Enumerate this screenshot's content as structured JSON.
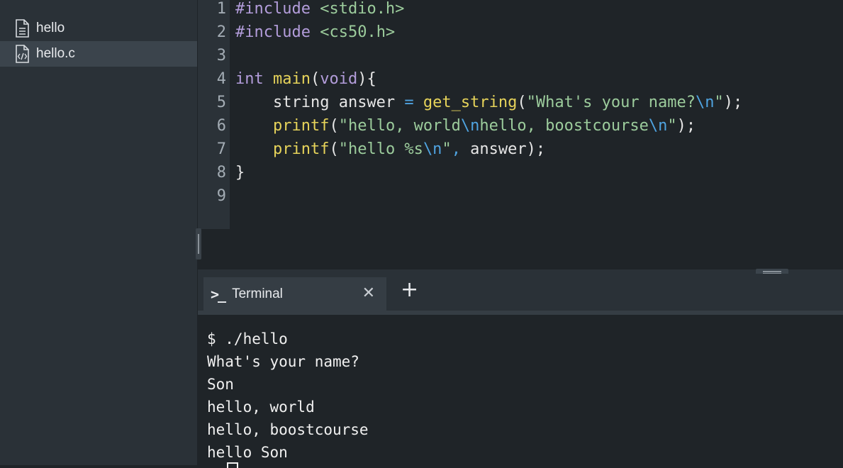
{
  "sidebar": {
    "files": [
      {
        "name": "hello",
        "icon": "text-file-icon",
        "selected": false
      },
      {
        "name": "hello.c",
        "icon": "code-file-icon",
        "selected": true
      }
    ]
  },
  "editor": {
    "line_numbers": [
      "1",
      "2",
      "3",
      "4",
      "5",
      "6",
      "7",
      "8",
      "9"
    ],
    "lines": [
      "#include <stdio.h>",
      "#include <cs50.h>",
      "",
      "int main(void){",
      "    string answer = get_string(\"What's your name?\\n\");",
      "    printf(\"hello, world\\nhello, boostcourse\\n\");",
      "    printf(\"hello %s\\n\", answer);",
      "}",
      ""
    ],
    "tokens": {
      "l1": {
        "a": "#include",
        "b": " ",
        "c": "<stdio.h>"
      },
      "l2": {
        "a": "#include",
        "b": " ",
        "c": "<cs50.h>"
      },
      "l4": {
        "kw1": "int",
        "sp1": " ",
        "fn": "main",
        "p1": "(",
        "kw2": "void",
        "p2": "){"
      },
      "l5": {
        "ind": "    ",
        "t1": "string answer ",
        "op": "=",
        "sp": " ",
        "fn": "get_string",
        "p1": "(",
        "s1": "\"What's your name?",
        "e1": "\\n",
        "s2": "\"",
        "p2": ");"
      },
      "l6": {
        "ind": "    ",
        "fn": "printf",
        "p1": "(",
        "s1": "\"hello, world",
        "e1": "\\n",
        "s2": "hello, boostcourse",
        "e2": "\\n",
        "s3": "\"",
        "p2": ");"
      },
      "l7": {
        "ind": "    ",
        "fn": "printf",
        "p1": "(",
        "s1": "\"hello %s",
        "e1": "\\n",
        "s2": "\"",
        "c": ",",
        "t": " answer);"
      },
      "l8": {
        "t": "}"
      }
    }
  },
  "terminal_tab": {
    "prompt_icon": ">_",
    "label": "Terminal",
    "close": "✕",
    "add": "+"
  },
  "terminal": {
    "lines": [
      "$ ./hello",
      "What's your name?",
      "Son",
      "hello, world",
      "hello, boostcourse",
      "hello Son"
    ]
  },
  "colors": {
    "background": "#1f2428",
    "sidebar": "#2a3137",
    "keyword": "#b39ddb",
    "function": "#e6d35a",
    "string": "#9ccc9c",
    "escape": "#4fa3e0"
  }
}
